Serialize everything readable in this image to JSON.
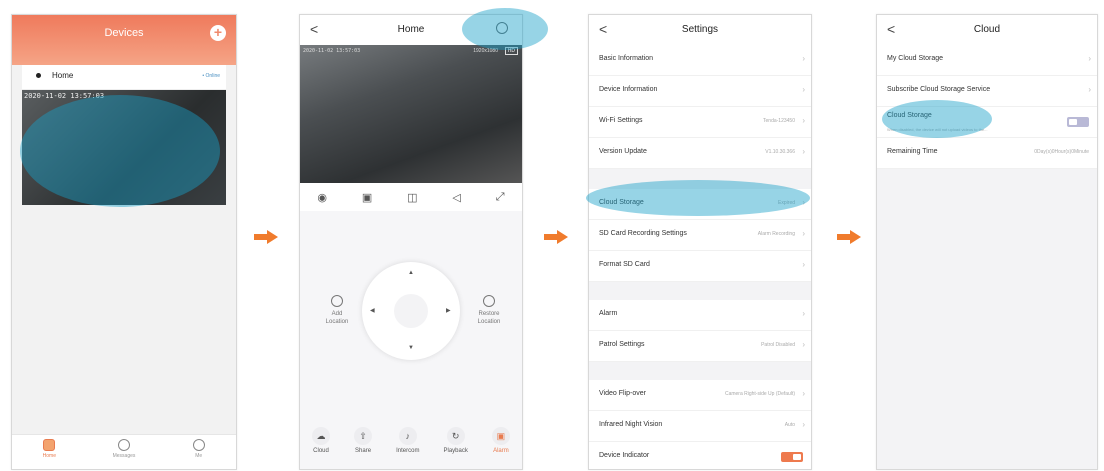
{
  "colors": {
    "accent": "#EE7A4E",
    "highlight": "#19A0C8",
    "header_gradient_top": "#EF7A5C"
  },
  "devices_screen": {
    "title": "Devices",
    "add_icon": "plus-circle-icon",
    "device_name": "Home",
    "device_status": "• Online",
    "timestamp": "2020-11-02 13:57:03",
    "tabs": [
      {
        "label": "Home",
        "icon": "home-icon"
      },
      {
        "label": "Messages",
        "icon": "message-icon"
      },
      {
        "label": "Me",
        "icon": "user-icon"
      }
    ]
  },
  "home_screen": {
    "title": "Home",
    "back": "<",
    "timestamp": "2020-11-02 13:57:03",
    "resolution": "1920x1080",
    "quality": "HD",
    "controls": [
      "eye-icon",
      "screenshot-icon",
      "record-icon",
      "speaker-icon",
      "fullscreen-icon"
    ],
    "ptz_arrows": {
      "up": "▲",
      "down": "▼",
      "left": "◀",
      "right": "▶"
    },
    "add_location": "Add\nLocation",
    "restore_location": "Restore\nLocation",
    "bottom_buttons": [
      {
        "label": "Cloud",
        "icon": "cloud-icon"
      },
      {
        "label": "Share",
        "icon": "share-icon"
      },
      {
        "label": "Intercom",
        "icon": "mic-icon"
      },
      {
        "label": "Playback",
        "icon": "playback-icon"
      },
      {
        "label": "Alarm",
        "icon": "alarm-icon"
      }
    ]
  },
  "settings_screen": {
    "title": "Settings",
    "back": "<",
    "rows": {
      "basic_info": "Basic Information",
      "device_info": "Device Information",
      "wifi": "Wi-Fi Settings",
      "wifi_value": "Tenda-123450",
      "version": "Version Update",
      "version_value": "V1.10.30.366",
      "cloud": "Cloud Storage",
      "cloud_value": "Expired",
      "sd_rec": "SD Card Recording Settings",
      "sd_rec_value": "Alarm Recording",
      "format_sd": "Format SD Card",
      "alarm": "Alarm",
      "patrol": "Patrol Settings",
      "patrol_value": "Patrol Disabled",
      "flip": "Video Flip-over",
      "flip_value": "Camera Right-side Up (Default)",
      "ir": "Infrared Night Vision",
      "ir_value": "Auto",
      "indicator": "Device Indicator"
    },
    "device_indicator_on": true
  },
  "cloud_screen": {
    "title": "Cloud",
    "back": "<",
    "rows": {
      "my_cloud": "My Cloud Storage",
      "subscribe": "Subscribe Cloud Storage Service",
      "cloud_storage": "Cloud Storage",
      "cloud_storage_sub": "When disabled, the device will not upload videos to the...",
      "remaining": "Remaining Time",
      "remaining_value": "0Day(s)0Hour(s)0Minute"
    },
    "cloud_storage_on": false
  }
}
